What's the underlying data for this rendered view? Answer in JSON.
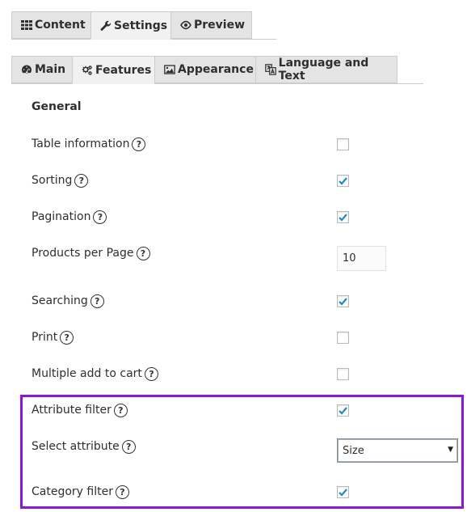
{
  "top_tabs": [
    {
      "label": "Content",
      "icon": "grid-icon",
      "active": false
    },
    {
      "label": "Settings",
      "icon": "wrench-icon",
      "active": true
    },
    {
      "label": "Preview",
      "icon": "eye-icon",
      "active": false
    }
  ],
  "sub_tabs": [
    {
      "label": "Main",
      "icon": "dashboard-icon",
      "active": false
    },
    {
      "label": "Features",
      "icon": "gears-icon",
      "active": true
    },
    {
      "label": "Appearance",
      "icon": "image-icon",
      "active": false
    },
    {
      "label": "Language and Text",
      "icon": "translate-icon",
      "active": false
    }
  ],
  "section": {
    "title": "General"
  },
  "rows": {
    "table_information": {
      "label": "Table information",
      "checked": false
    },
    "sorting": {
      "label": "Sorting",
      "checked": true
    },
    "pagination": {
      "label": "Pagination",
      "checked": true
    },
    "products_per_page": {
      "label": "Products per Page",
      "value": "10"
    },
    "searching": {
      "label": "Searching",
      "checked": true
    },
    "print": {
      "label": "Print",
      "checked": false
    },
    "multiple_add_to_cart": {
      "label": "Multiple add to cart",
      "checked": false
    },
    "attribute_filter": {
      "label": "Attribute filter",
      "checked": true
    },
    "select_attribute": {
      "label": "Select attribute",
      "value": "Size"
    },
    "category_filter": {
      "label": "Category filter",
      "checked": true
    }
  },
  "help_glyph": "?",
  "colors": {
    "highlight": "#8c17d4",
    "check": "#1e8cbe"
  }
}
